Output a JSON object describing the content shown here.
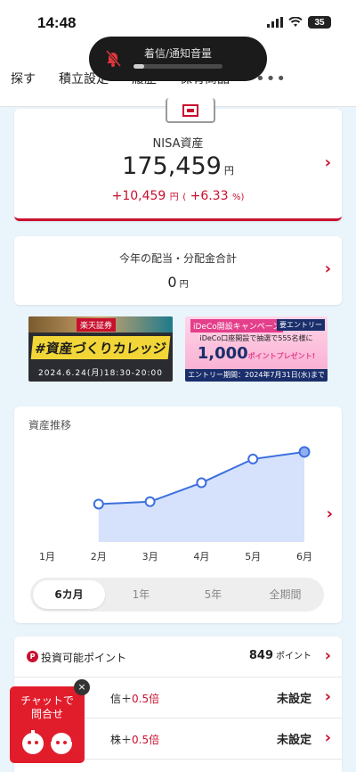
{
  "status_bar": {
    "time": "14:48",
    "battery": "35"
  },
  "notification": {
    "text": "着信/通知音量",
    "volume_fraction": 0.12
  },
  "nav": {
    "tabs": [
      "探す",
      "積立設定",
      "履歴",
      "保有商品"
    ],
    "more": "•••"
  },
  "nisa": {
    "label": "NISA資産",
    "value": "175,459",
    "unit": "円",
    "gain_amount": "+10,459",
    "gain_unit": "円",
    "gain_pct": "+6.33",
    "pct_unit": "%"
  },
  "dividend": {
    "label": "今年の配当・分配金合計",
    "value": "0",
    "unit": "円"
  },
  "banners": {
    "left": {
      "brand": "楽天証券",
      "title": "#資産づくりカレッジ",
      "date": "2024.6.24(月)18:30-20:00"
    },
    "right": {
      "header": "iDeCo開設キャンペーン",
      "entry": "要エントリー",
      "sub": "iDeCo口座開設で抽選で555名様に",
      "points": "1,000",
      "points_suffix": "ポイントプレゼント!",
      "period": "エントリー期間：2024年7月31日(水)まで"
    }
  },
  "chart_section": {
    "title": "資産推移",
    "periods": [
      "6カ月",
      "1年",
      "5年",
      "全期間"
    ],
    "active_period": "6カ月"
  },
  "chart_data": {
    "type": "area",
    "categories": [
      "1月",
      "2月",
      "3月",
      "4月",
      "5月",
      "6月"
    ],
    "x": [
      "2月",
      "3月",
      "4月",
      "5月",
      "6月"
    ],
    "values": [
      80,
      85,
      125,
      175,
      190
    ],
    "ylim": [
      0,
      220
    ],
    "color": "#3b6fe0",
    "fill": "#d6e2fb",
    "grid": false
  },
  "list": {
    "rows": [
      {
        "label": "投資可能ポイント",
        "value": "849",
        "unit": "ポイント"
      },
      {
        "label_prefix": "信＋",
        "accent": "0.5倍",
        "value": "未設定"
      },
      {
        "label_prefix": "株＋",
        "accent": "0.5倍",
        "value": "未設定"
      }
    ]
  },
  "chat": {
    "line1": "チャットで",
    "line2": "問合せ",
    "close": "×"
  },
  "colors": {
    "accent": "#c8102e",
    "chart_line": "#3b6fe0",
    "background": "#eaf4fb"
  }
}
